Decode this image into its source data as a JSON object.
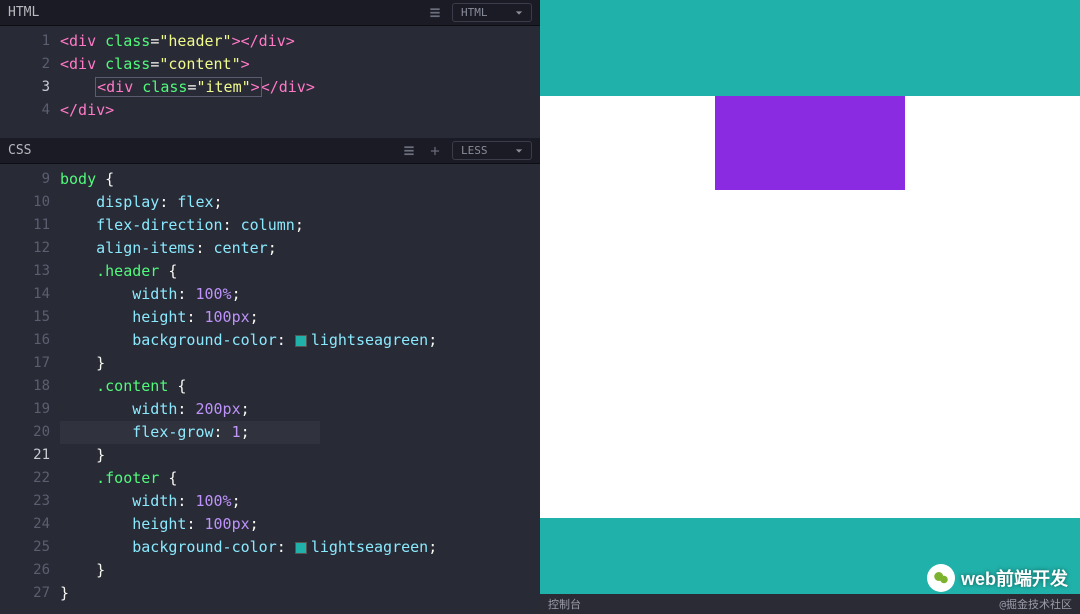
{
  "panels": {
    "html": {
      "title": "HTML",
      "lang": "HTML"
    },
    "css": {
      "title": "CSS",
      "lang": "LESS"
    }
  },
  "html_lines": {
    "l1": {
      "n": "1",
      "a": "<div ",
      "b": "class",
      "c": "=",
      "d": "\"header\"",
      "e": "></div>"
    },
    "l2": {
      "n": "2",
      "a": "<div ",
      "b": "class",
      "c": "=",
      "d": "\"content\"",
      "e": ">"
    },
    "l3": {
      "n": "3",
      "a": "<div ",
      "b": "class",
      "c": "=",
      "d": "\"item\"",
      "e": ">",
      "f": "</div>"
    },
    "l4": {
      "n": "4",
      "a": "</div>"
    }
  },
  "css_lines": {
    "l9": {
      "n": "9",
      "t": "body {"
    },
    "l10": {
      "n": "10",
      "p": "display",
      "v": "flex"
    },
    "l11": {
      "n": "11",
      "p": "flex-direction",
      "v": "column"
    },
    "l12": {
      "n": "12",
      "p": "align-items",
      "v": "center"
    },
    "l13": {
      "n": "13",
      "s": ".header",
      "b": "{"
    },
    "l14": {
      "n": "14",
      "p": "width",
      "v": "100%"
    },
    "l15": {
      "n": "15",
      "p": "height",
      "v": "100px"
    },
    "l16": {
      "n": "16",
      "p": "background-color",
      "sw": "#20b2aa",
      "v": "lightseagreen"
    },
    "l17": {
      "n": "17",
      "b": "}"
    },
    "l18": {
      "n": "18",
      "s": ".content",
      "b": "{"
    },
    "l19": {
      "n": "19",
      "p": "width",
      "v": "200px"
    },
    "l20": {
      "n": "20",
      "p": "flex-grow",
      "v": "1"
    },
    "l21": {
      "n": "21",
      "b": "}"
    },
    "l22": {
      "n": "22",
      "s": ".footer",
      "b": "{"
    },
    "l23": {
      "n": "23",
      "p": "width",
      "v": "100%"
    },
    "l24": {
      "n": "24",
      "p": "height",
      "v": "100px"
    },
    "l25": {
      "n": "25",
      "p": "background-color",
      "sw": "#20b2aa",
      "v": "lightseagreen"
    },
    "l26": {
      "n": "26",
      "b": "}"
    },
    "l27": {
      "n": "27",
      "b": "}"
    }
  },
  "console": {
    "label": "控制台",
    "credit": "@掘金技术社区"
  },
  "watermark": {
    "text": "web前端开发"
  }
}
